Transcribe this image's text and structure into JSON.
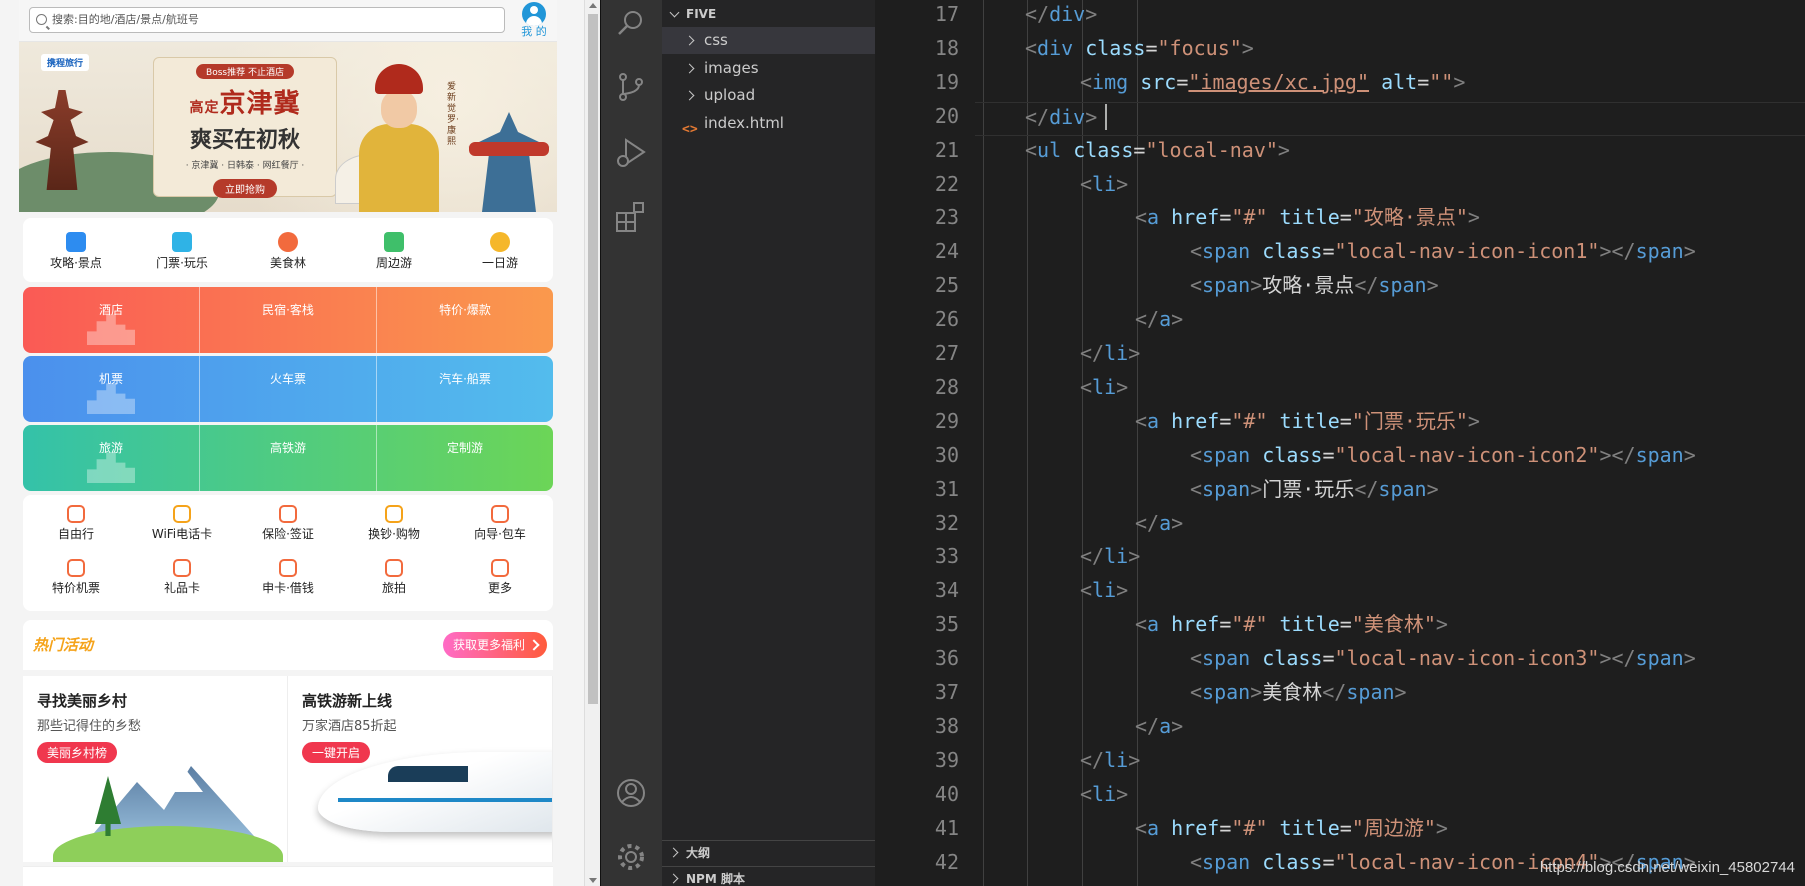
{
  "preview": {
    "search_placeholder": "搜索:目的地/酒店/景点/航班号",
    "user_label": "我 的",
    "banner": {
      "logo": "携程旅行",
      "badge": "Boss推荐 不止酒店",
      "headline": "京津冀",
      "headline_prefix": "高定",
      "subheadline": "爽买在初秋",
      "tagline": "· 京津冀 · 日韩泰 · 网红餐厅 ·",
      "cta": "立即抢购",
      "vertical_text": "爱新觉罗·康熙"
    },
    "local_nav": [
      {
        "label": "攻略·景点",
        "color": "#2d8cf0",
        "icon": "book-icon"
      },
      {
        "label": "门票·玩乐",
        "color": "#2fb3e6",
        "icon": "ticket-icon"
      },
      {
        "label": "美食林",
        "color": "#f26a3d",
        "icon": "food-icon"
      },
      {
        "label": "周边游",
        "color": "#3fbf6a",
        "icon": "mountain-icon"
      },
      {
        "label": "一日游",
        "color": "#f5b72a",
        "icon": "sun-icon"
      }
    ],
    "grid": {
      "hotel": [
        "酒店",
        "民宿·客栈",
        "特价·爆款"
      ],
      "flight": [
        "机票",
        "火车票",
        "汽车·船票"
      ],
      "travel": [
        "旅游",
        "高铁游",
        "定制游"
      ]
    },
    "sub_nav": [
      [
        {
          "label": "自由行",
          "color": "#f26a3d",
          "icon": "backpack-icon"
        },
        {
          "label": "WiFi电话卡",
          "color": "#f5a31a",
          "icon": "wifi-card-icon"
        },
        {
          "label": "保险·签证",
          "color": "#f26a3d",
          "icon": "shield-icon"
        },
        {
          "label": "换钞·购物",
          "color": "#f5a31a",
          "icon": "bag-icon"
        },
        {
          "label": "向导·包车",
          "color": "#f26a3d",
          "icon": "guide-icon"
        }
      ],
      [
        {
          "label": "特价机票",
          "color": "#f26a3d",
          "icon": "plane-icon"
        },
        {
          "label": "礼品卡",
          "color": "#f26a3d",
          "icon": "gift-card-icon"
        },
        {
          "label": "申卡·借钱",
          "color": "#f26a3d",
          "icon": "card-icon"
        },
        {
          "label": "旅拍",
          "color": "#f26a3d",
          "icon": "camera-icon"
        },
        {
          "label": "更多",
          "color": "#f26a3d",
          "icon": "more-icon"
        }
      ]
    ],
    "hot": {
      "title": "热门活动",
      "more": "获取更多福利"
    },
    "promos": [
      {
        "title": "寻找美丽乡村",
        "subtitle": "那些记得住的乡愁",
        "button": "美丽乡村榜"
      },
      {
        "title": "高铁游新上线",
        "subtitle": "万家酒店85折起",
        "button": "一键开启"
      }
    ]
  },
  "explorer": {
    "root": "FIVE",
    "items": [
      {
        "label": "css",
        "type": "folder"
      },
      {
        "label": "images",
        "type": "folder"
      },
      {
        "label": "upload",
        "type": "folder"
      },
      {
        "label": "index.html",
        "type": "file",
        "icon": "<>"
      }
    ],
    "panels": [
      "大纲",
      "NPM 脚本"
    ]
  },
  "editor": {
    "lines": [
      {
        "n": "17",
        "indent": 2,
        "tokens": [
          [
            "br",
            "</"
          ],
          [
            "tag",
            "div"
          ],
          [
            "br",
            ">"
          ]
        ]
      },
      {
        "n": "18",
        "indent": 2,
        "tokens": [
          [
            "br",
            "<"
          ],
          [
            "tag",
            "div"
          ],
          [
            "tx",
            " "
          ],
          [
            "at",
            "class"
          ],
          [
            "tx",
            "="
          ],
          [
            "st",
            "\"focus\""
          ],
          [
            "br",
            ">"
          ]
        ]
      },
      {
        "n": "19",
        "indent": 3,
        "tokens": [
          [
            "br",
            "<"
          ],
          [
            "tag",
            "img"
          ],
          [
            "tx",
            " "
          ],
          [
            "at",
            "src"
          ],
          [
            "tx",
            "="
          ],
          [
            "st",
            "\"images/xc.jpg\""
          ],
          [
            "tx",
            " "
          ],
          [
            "at",
            "alt"
          ],
          [
            "tx",
            "="
          ],
          [
            "st",
            "\"\""
          ],
          [
            "br",
            ">"
          ]
        ]
      },
      {
        "n": "20",
        "indent": 2,
        "tokens": [
          [
            "br",
            "</"
          ],
          [
            "tag",
            "div"
          ],
          [
            "br",
            ">"
          ]
        ]
      },
      {
        "n": "21",
        "indent": 2,
        "tokens": [
          [
            "br",
            "<"
          ],
          [
            "tag",
            "ul"
          ],
          [
            "tx",
            " "
          ],
          [
            "at",
            "class"
          ],
          [
            "tx",
            "="
          ],
          [
            "st",
            "\"local-nav\""
          ],
          [
            "br",
            ">"
          ]
        ]
      },
      {
        "n": "22",
        "indent": 3,
        "tokens": [
          [
            "br",
            "<"
          ],
          [
            "tag",
            "li"
          ],
          [
            "br",
            ">"
          ]
        ]
      },
      {
        "n": "23",
        "indent": 4,
        "tokens": [
          [
            "br",
            "<"
          ],
          [
            "tag",
            "a"
          ],
          [
            "tx",
            " "
          ],
          [
            "at",
            "href"
          ],
          [
            "tx",
            "="
          ],
          [
            "st",
            "\"#\""
          ],
          [
            "tx",
            " "
          ],
          [
            "at",
            "title"
          ],
          [
            "tx",
            "="
          ],
          [
            "st",
            "\"攻略·景点\""
          ],
          [
            "br",
            ">"
          ]
        ]
      },
      {
        "n": "24",
        "indent": 5,
        "tokens": [
          [
            "br",
            "<"
          ],
          [
            "tag",
            "span"
          ],
          [
            "tx",
            " "
          ],
          [
            "at",
            "class"
          ],
          [
            "tx",
            "="
          ],
          [
            "st",
            "\"local-nav-icon-icon1\""
          ],
          [
            "br",
            "></"
          ],
          [
            "tag",
            "span"
          ],
          [
            "br",
            ">"
          ]
        ]
      },
      {
        "n": "25",
        "indent": 5,
        "tokens": [
          [
            "br",
            "<"
          ],
          [
            "tag",
            "span"
          ],
          [
            "br",
            ">"
          ],
          [
            "tx",
            "攻略·景点"
          ],
          [
            "br",
            "</"
          ],
          [
            "tag",
            "span"
          ],
          [
            "br",
            ">"
          ]
        ]
      },
      {
        "n": "26",
        "indent": 4,
        "tokens": [
          [
            "br",
            "</"
          ],
          [
            "tag",
            "a"
          ],
          [
            "br",
            ">"
          ]
        ]
      },
      {
        "n": "27",
        "indent": 3,
        "tokens": [
          [
            "br",
            "</"
          ],
          [
            "tag",
            "li"
          ],
          [
            "br",
            ">"
          ]
        ]
      },
      {
        "n": "28",
        "indent": 3,
        "tokens": [
          [
            "br",
            "<"
          ],
          [
            "tag",
            "li"
          ],
          [
            "br",
            ">"
          ]
        ]
      },
      {
        "n": "29",
        "indent": 4,
        "tokens": [
          [
            "br",
            "<"
          ],
          [
            "tag",
            "a"
          ],
          [
            "tx",
            " "
          ],
          [
            "at",
            "href"
          ],
          [
            "tx",
            "="
          ],
          [
            "st",
            "\"#\""
          ],
          [
            "tx",
            " "
          ],
          [
            "at",
            "title"
          ],
          [
            "tx",
            "="
          ],
          [
            "st",
            "\"门票·玩乐\""
          ],
          [
            "br",
            ">"
          ]
        ]
      },
      {
        "n": "30",
        "indent": 5,
        "tokens": [
          [
            "br",
            "<"
          ],
          [
            "tag",
            "span"
          ],
          [
            "tx",
            " "
          ],
          [
            "at",
            "class"
          ],
          [
            "tx",
            "="
          ],
          [
            "st",
            "\"local-nav-icon-icon2\""
          ],
          [
            "br",
            "></"
          ],
          [
            "tag",
            "span"
          ],
          [
            "br",
            ">"
          ]
        ]
      },
      {
        "n": "31",
        "indent": 5,
        "tokens": [
          [
            "br",
            "<"
          ],
          [
            "tag",
            "span"
          ],
          [
            "br",
            ">"
          ],
          [
            "tx",
            "门票·玩乐"
          ],
          [
            "br",
            "</"
          ],
          [
            "tag",
            "span"
          ],
          [
            "br",
            ">"
          ]
        ]
      },
      {
        "n": "32",
        "indent": 4,
        "tokens": [
          [
            "br",
            "</"
          ],
          [
            "tag",
            "a"
          ],
          [
            "br",
            ">"
          ]
        ]
      },
      {
        "n": "33",
        "indent": 3,
        "tokens": [
          [
            "br",
            "</"
          ],
          [
            "tag",
            "li"
          ],
          [
            "br",
            ">"
          ]
        ]
      },
      {
        "n": "34",
        "indent": 3,
        "tokens": [
          [
            "br",
            "<"
          ],
          [
            "tag",
            "li"
          ],
          [
            "br",
            ">"
          ]
        ]
      },
      {
        "n": "35",
        "indent": 4,
        "tokens": [
          [
            "br",
            "<"
          ],
          [
            "tag",
            "a"
          ],
          [
            "tx",
            " "
          ],
          [
            "at",
            "href"
          ],
          [
            "tx",
            "="
          ],
          [
            "st",
            "\"#\""
          ],
          [
            "tx",
            " "
          ],
          [
            "at",
            "title"
          ],
          [
            "tx",
            "="
          ],
          [
            "st",
            "\"美食林\""
          ],
          [
            "br",
            ">"
          ]
        ]
      },
      {
        "n": "36",
        "indent": 5,
        "tokens": [
          [
            "br",
            "<"
          ],
          [
            "tag",
            "span"
          ],
          [
            "tx",
            " "
          ],
          [
            "at",
            "class"
          ],
          [
            "tx",
            "="
          ],
          [
            "st",
            "\"local-nav-icon-icon3\""
          ],
          [
            "br",
            "></"
          ],
          [
            "tag",
            "span"
          ],
          [
            "br",
            ">"
          ]
        ]
      },
      {
        "n": "37",
        "indent": 5,
        "tokens": [
          [
            "br",
            "<"
          ],
          [
            "tag",
            "span"
          ],
          [
            "br",
            ">"
          ],
          [
            "tx",
            "美食林"
          ],
          [
            "br",
            "</"
          ],
          [
            "tag",
            "span"
          ],
          [
            "br",
            ">"
          ]
        ]
      },
      {
        "n": "38",
        "indent": 4,
        "tokens": [
          [
            "br",
            "</"
          ],
          [
            "tag",
            "a"
          ],
          [
            "br",
            ">"
          ]
        ]
      },
      {
        "n": "39",
        "indent": 3,
        "tokens": [
          [
            "br",
            "</"
          ],
          [
            "tag",
            "li"
          ],
          [
            "br",
            ">"
          ]
        ]
      },
      {
        "n": "40",
        "indent": 3,
        "tokens": [
          [
            "br",
            "<"
          ],
          [
            "tag",
            "li"
          ],
          [
            "br",
            ">"
          ]
        ]
      },
      {
        "n": "41",
        "indent": 4,
        "tokens": [
          [
            "br",
            "<"
          ],
          [
            "tag",
            "a"
          ],
          [
            "tx",
            " "
          ],
          [
            "at",
            "href"
          ],
          [
            "tx",
            "="
          ],
          [
            "st",
            "\"#\""
          ],
          [
            "tx",
            " "
          ],
          [
            "at",
            "title"
          ],
          [
            "tx",
            "="
          ],
          [
            "st",
            "\"周边游\""
          ],
          [
            "br",
            ">"
          ]
        ]
      },
      {
        "n": "42",
        "indent": 5,
        "tokens": [
          [
            "br",
            "<"
          ],
          [
            "tag",
            "span"
          ],
          [
            "tx",
            " "
          ],
          [
            "at",
            "class"
          ],
          [
            "tx",
            "="
          ],
          [
            "st",
            "\"local-nav-icon-icon4\""
          ],
          [
            "br",
            "></"
          ],
          [
            "tag",
            "span"
          ],
          [
            "br",
            ">"
          ]
        ]
      }
    ]
  },
  "watermark": "https://blog.csdn.net/weixin_45802744"
}
